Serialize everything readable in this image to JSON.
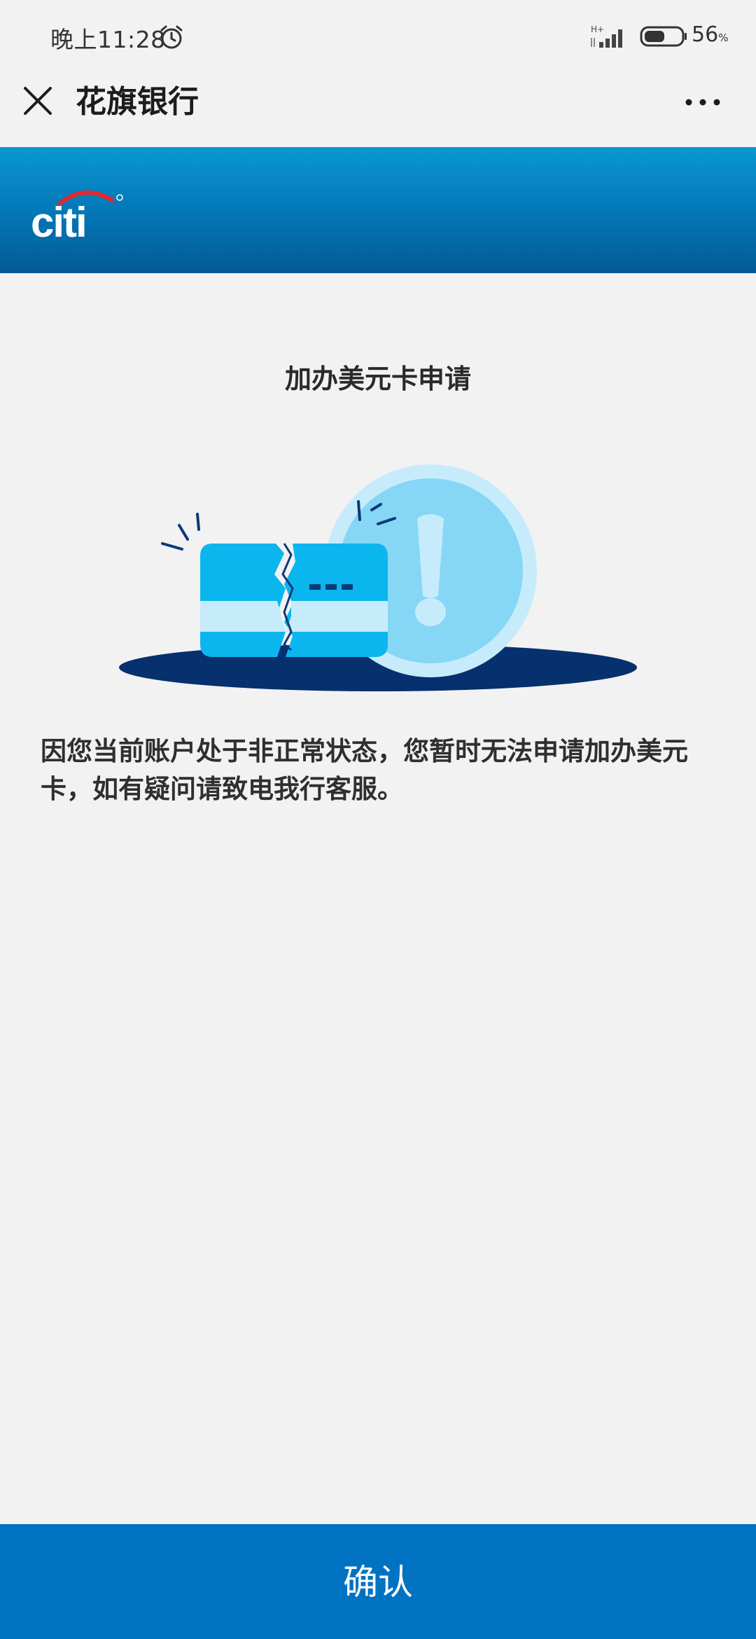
{
  "status_bar": {
    "time": "晚上11:28",
    "network": "H+",
    "battery_percent": "56",
    "battery_unit": "%",
    "battery_level": 0.56
  },
  "nav": {
    "title": "花旗银行",
    "close_icon": "close-icon",
    "more_icon": "more-icon"
  },
  "banner": {
    "logo_text": "citi",
    "background_color": "#0478b8"
  },
  "content": {
    "title": "加办美元卡申请",
    "illustration": "broken-card-warning",
    "message": "因您当前账户处于非正常状态，您暂时无法申请加办美元卡，如有疑问请致电我行客服。"
  },
  "footer": {
    "confirm_label": "确认",
    "confirm_color": "#0072c2"
  }
}
